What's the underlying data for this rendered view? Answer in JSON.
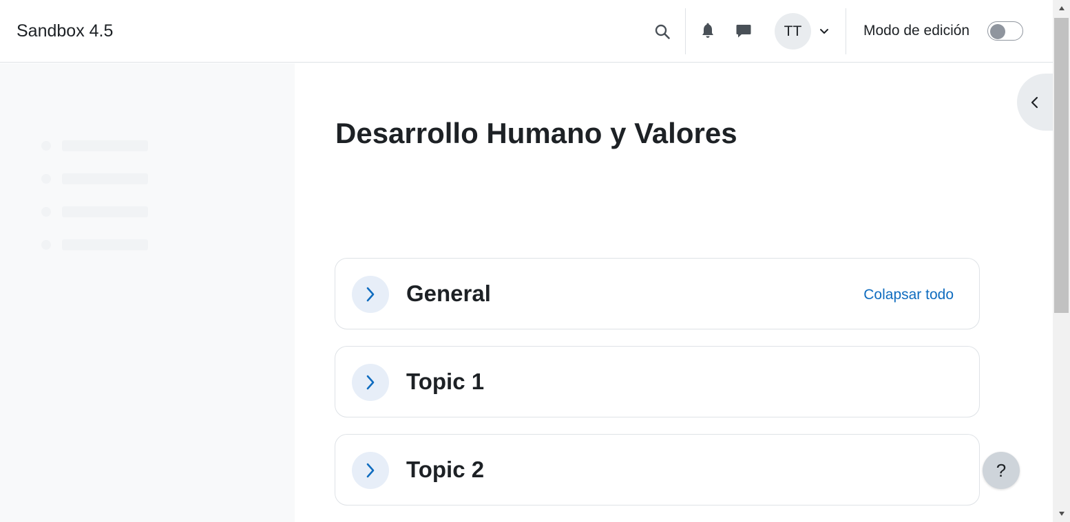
{
  "navbar": {
    "brand": "Sandbox 4.5",
    "avatar_initials": "TT",
    "edit_mode_label": "Modo de edición",
    "edit_mode_on": false
  },
  "icons": {
    "search": "search-icon",
    "notifications": "bell-icon",
    "messages": "message-icon",
    "user_menu": "chevron-down-icon",
    "drawer_toggle": "chevron-left-icon",
    "section_toggle": "chevron-right-icon"
  },
  "main": {
    "course_title": "Desarrollo Humano y Valores",
    "collapse_all": "Colapsar todo",
    "sections": [
      {
        "title": "General"
      },
      {
        "title": "Topic 1"
      },
      {
        "title": "Topic 2"
      }
    ]
  },
  "help": {
    "label": "?"
  },
  "colors": {
    "link": "#0f6cbf",
    "drawer_bg": "#f8f9fa",
    "chevron_circle": "#e7eef8",
    "help_bg": "#ced4da"
  }
}
